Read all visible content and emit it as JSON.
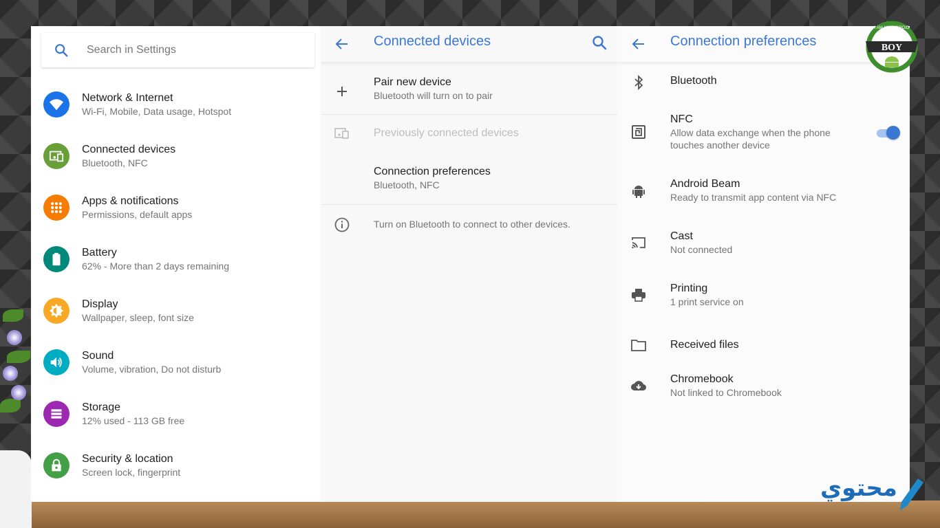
{
  "left": {
    "search_placeholder": "Search in Settings",
    "categories": [
      {
        "title": "Network & Internet",
        "subtitle": "Wi-Fi, Mobile, Data usage, Hotspot",
        "color": "#1a73e8",
        "icon": "wifi-icon"
      },
      {
        "title": "Connected devices",
        "subtitle": "Bluetooth, NFC",
        "color": "#689f38",
        "icon": "devices-icon"
      },
      {
        "title": "Apps & notifications",
        "subtitle": "Permissions, default apps",
        "color": "#f57c00",
        "icon": "apps-grid-icon"
      },
      {
        "title": "Battery",
        "subtitle": "62% - More than 2 days remaining",
        "color": "#00897b",
        "icon": "battery-icon"
      },
      {
        "title": "Display",
        "subtitle": "Wallpaper, sleep, font size",
        "color": "#f9a825",
        "icon": "brightness-icon"
      },
      {
        "title": "Sound",
        "subtitle": "Volume, vibration, Do not disturb",
        "color": "#00acc1",
        "icon": "volume-icon"
      },
      {
        "title": "Storage",
        "subtitle": "12% used - 113 GB free",
        "color": "#9c27b0",
        "icon": "storage-icon"
      },
      {
        "title": "Security & location",
        "subtitle": "Screen lock, fingerprint",
        "color": "#43a047",
        "icon": "lock-icon"
      }
    ]
  },
  "middle": {
    "title": "Connected devices",
    "pair": {
      "title": "Pair new device",
      "subtitle": "Bluetooth will turn on to pair"
    },
    "previous": {
      "title": "Previously connected devices"
    },
    "prefs": {
      "title": "Connection preferences",
      "subtitle": "Bluetooth, NFC"
    },
    "info": "Turn on Bluetooth to connect to other devices."
  },
  "right": {
    "title": "Connection preferences",
    "items": [
      {
        "title": "Bluetooth",
        "subtitle": "",
        "icon": "bluetooth-icon"
      },
      {
        "title": "NFC",
        "subtitle": "Allow data exchange when the phone touches another device",
        "icon": "nfc-icon",
        "toggle": true
      },
      {
        "title": "Android Beam",
        "subtitle": "Ready to transmit app content via NFC",
        "icon": "android-icon"
      },
      {
        "title": "Cast",
        "subtitle": "Not connected",
        "icon": "cast-icon"
      },
      {
        "title": "Printing",
        "subtitle": "1 print service on",
        "icon": "printer-icon"
      },
      {
        "title": "Received files",
        "subtitle": "",
        "icon": "folder-icon"
      },
      {
        "title": "Chromebook",
        "subtitle": "Not linked to Chromebook",
        "icon": "cloud-download-icon"
      }
    ]
  },
  "logo_text": "BOY",
  "logo_ring": "I AM AN ANDROID",
  "watermark_text": "محتوي",
  "accent_color": "#3b78d4"
}
